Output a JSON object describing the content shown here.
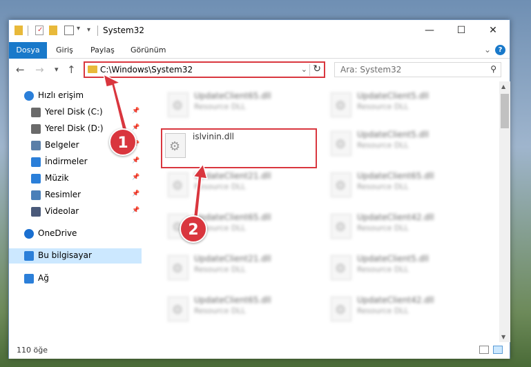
{
  "titlebar": {
    "title": "System32",
    "minimize": "—",
    "maximize": "☐",
    "close": "✕"
  },
  "ribbon": {
    "tabs": [
      "Dosya",
      "Giriş",
      "Paylaş",
      "Görünüm"
    ],
    "collapse_icon": "chevron-down-icon",
    "help": "?"
  },
  "nav": {
    "back": "←",
    "forward": "→",
    "recent": "▾",
    "up": "↑",
    "address": "C:\\Windows\\System32",
    "search_placeholder": "Ara: System32"
  },
  "sidebar": {
    "items": [
      {
        "label": "Hızlı erişim",
        "icon": "star-icon",
        "pinned": false
      },
      {
        "label": "Yerel Disk (C:)",
        "icon": "drive-icon",
        "pinned": true
      },
      {
        "label": "Yerel Disk (D:)",
        "icon": "drive-icon",
        "pinned": true
      },
      {
        "label": "Belgeler",
        "icon": "documents-icon",
        "pinned": true
      },
      {
        "label": "İndirmeler",
        "icon": "downloads-icon",
        "pinned": true
      },
      {
        "label": "Müzik",
        "icon": "music-icon",
        "pinned": true
      },
      {
        "label": "Resimler",
        "icon": "pictures-icon",
        "pinned": true
      },
      {
        "label": "Videolar",
        "icon": "videos-icon",
        "pinned": true
      },
      {
        "label": "OneDrive",
        "icon": "onedrive-icon",
        "pinned": false
      },
      {
        "label": "Bu bilgisayar",
        "icon": "computer-icon",
        "pinned": false,
        "selected": true
      },
      {
        "label": "Ağ",
        "icon": "network-icon",
        "pinned": false
      }
    ]
  },
  "files": {
    "left": [
      {
        "name": "UpdateClient65.dll",
        "type": "Resource DLL"
      },
      {
        "name": "islvinin.dll",
        "type": "",
        "highlighted": true
      },
      {
        "name": "UpdateClient21.dll",
        "type": "Resource DLL"
      },
      {
        "name": "UpdateClient65.dll",
        "type": "Resource DLL"
      },
      {
        "name": "UpdateClient21.dll",
        "type": "Resource DLL"
      },
      {
        "name": "UpdateClient65.dll",
        "type": "Resource DLL"
      }
    ],
    "right": [
      {
        "name": "UpdateClient5.dll",
        "type": "Resource DLL"
      },
      {
        "name": "UpdateClient5.dll",
        "type": "Resource DLL"
      },
      {
        "name": "UpdateClient65.dll",
        "type": "Resource DLL"
      },
      {
        "name": "UpdateClient42.dll",
        "type": "Resource DLL"
      },
      {
        "name": "UpdateClient5.dll",
        "type": "Resource DLL"
      },
      {
        "name": "UpdateClient42.dll",
        "type": "Resource DLL"
      }
    ]
  },
  "status": {
    "count": "110 öğe"
  },
  "annotations": {
    "step1": "1",
    "step2": "2",
    "color": "#d9363e"
  }
}
